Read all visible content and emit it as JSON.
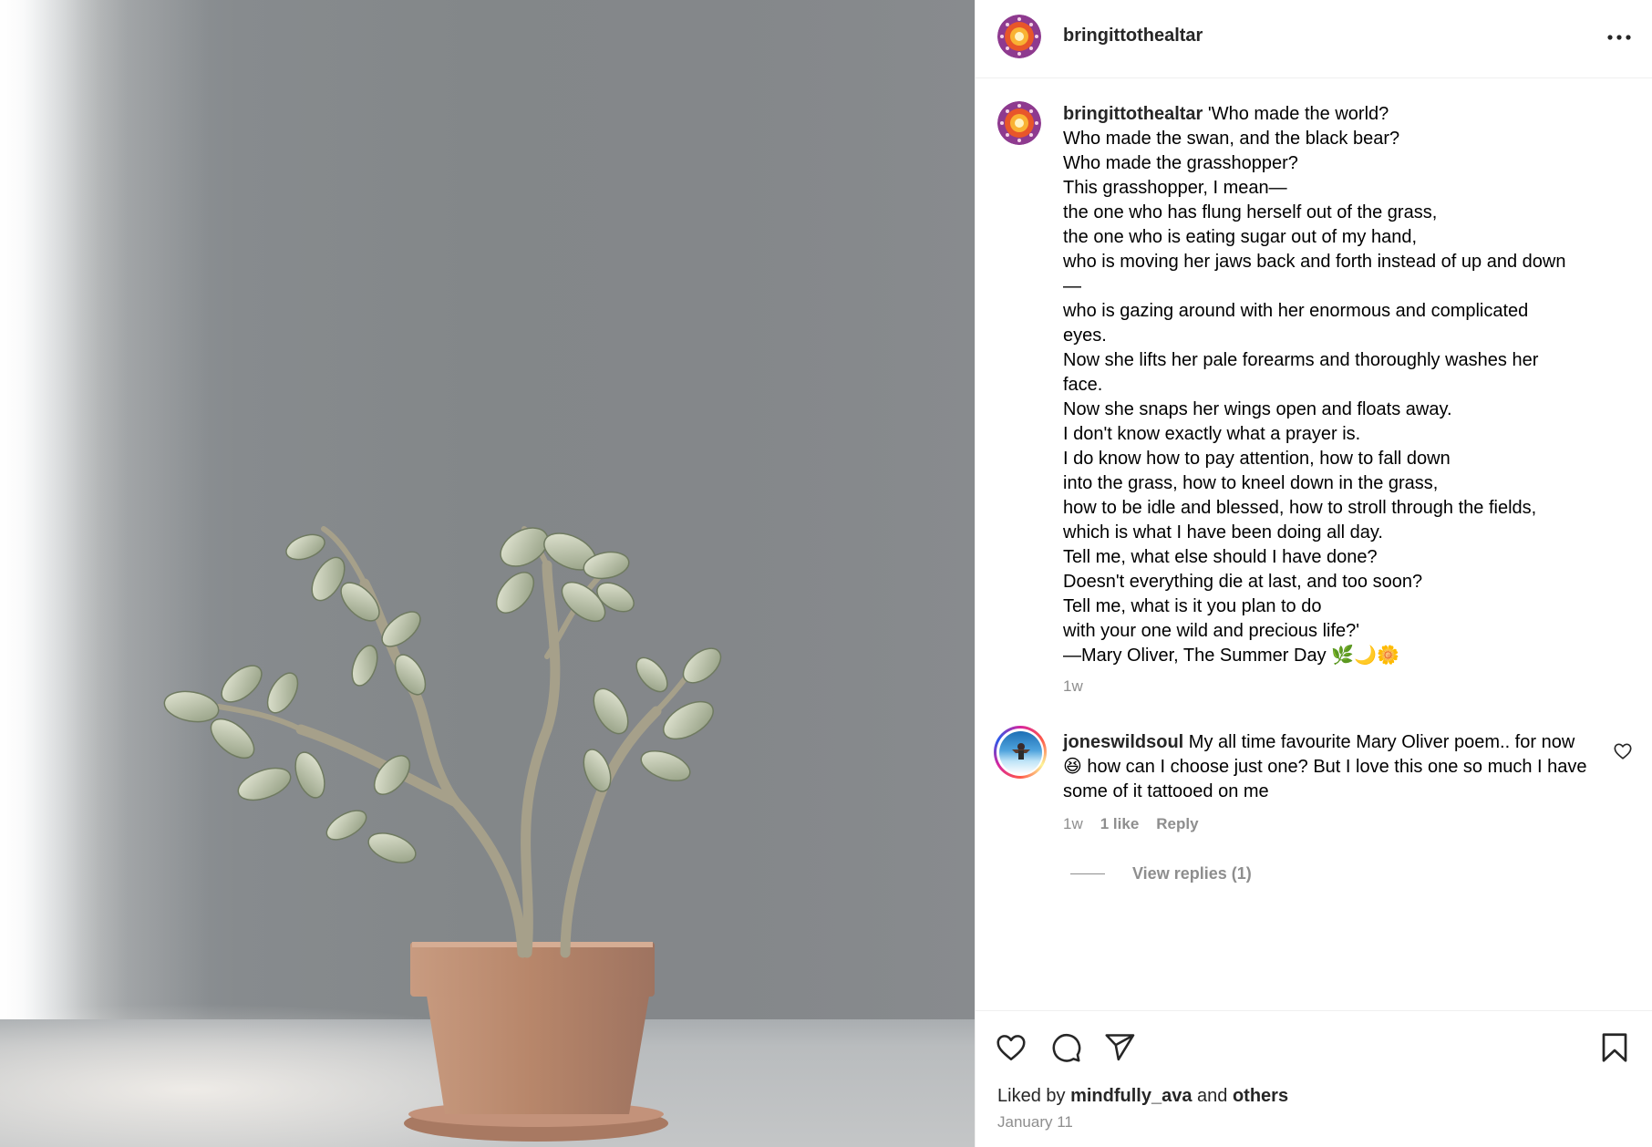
{
  "post": {
    "username": "bringittothealtar",
    "caption_username": "bringittothealtar",
    "caption_text": " 'Who made the world?\nWho made the swan, and the black bear?\nWho made the grasshopper?\nThis grasshopper, I mean—\nthe one who has flung herself out of the grass,\nthe one who is eating sugar out of my hand,\nwho is moving her jaws back and forth instead of up and down\n—\nwho is gazing around with her enormous and complicated\neyes.\nNow she lifts her pale forearms and thoroughly washes her\nface.\nNow she snaps her wings open and floats away.\nI don't know exactly what a prayer is.\nI do know how to pay attention, how to fall down\ninto the grass, how to kneel down in the grass,\nhow to be idle and blessed, how to stroll through the fields,\nwhich is what I have been doing all day.\nTell me, what else should I have done?\nDoesn't everything die at last, and too soon?\nTell me, what is it you plan to do\nwith your one wild and precious life?'\n—Mary Oliver, The Summer Day 🌿🌙🌼",
    "caption_time": "1w"
  },
  "comment": {
    "username": "joneswildsoul",
    "text": " My all time favourite Mary Oliver poem.. for now 😆 how can I choose just one? But I love this one so much I have some of it tattooed on me",
    "time": "1w",
    "likes": "1 like",
    "reply_label": "Reply",
    "view_replies": "View replies (1)"
  },
  "footer": {
    "liked_by_prefix": "Liked by ",
    "liked_by_user": "mindfully_ava",
    "liked_by_and": " and ",
    "liked_by_others": "others",
    "date": "January 11"
  },
  "icons": {
    "more": "more-horizontal-icon",
    "like": "heart-icon",
    "comment": "comment-icon",
    "share": "send-icon",
    "save": "bookmark-icon"
  },
  "colors": {
    "text_primary": "#262626",
    "text_secondary": "#8e8e8e",
    "divider": "#efefef"
  }
}
